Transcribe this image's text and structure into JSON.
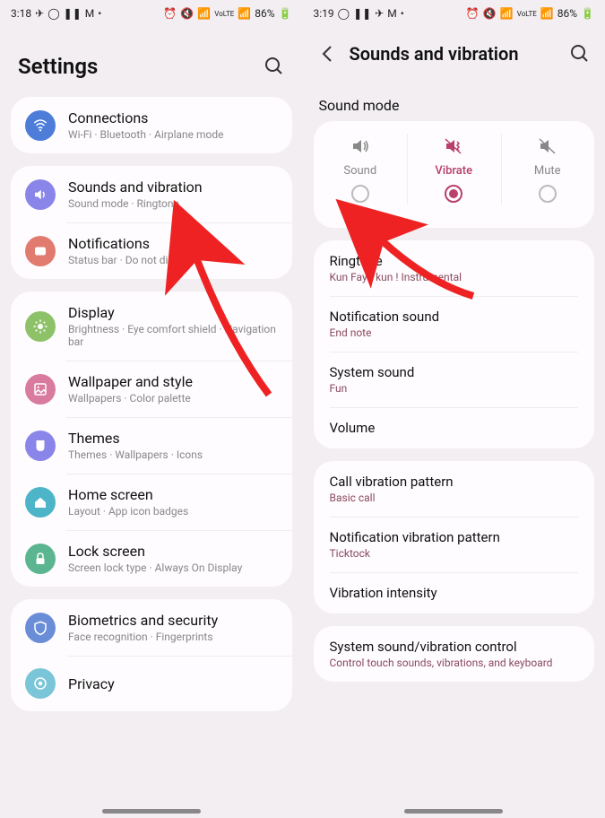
{
  "left": {
    "statusbar": {
      "time": "3:18",
      "battery": "86%"
    },
    "header": {
      "title": "Settings"
    },
    "groups": [
      {
        "items": [
          {
            "title": "Connections",
            "sub": "Wi-Fi · Bluetooth · Airplane mode",
            "color": "#4d7dd8",
            "icon": "wifi"
          }
        ]
      },
      {
        "items": [
          {
            "title": "Sounds and vibration",
            "sub": "Sound mode · Ringtone",
            "color": "#8a85e8",
            "icon": "sound"
          },
          {
            "title": "Notifications",
            "sub": "Status bar · Do not disturb",
            "color": "#e27b6f",
            "icon": "notif"
          }
        ]
      },
      {
        "items": [
          {
            "title": "Display",
            "sub": "Brightness · Eye comfort shield · Navigation bar",
            "color": "#8ec268",
            "icon": "brightness"
          },
          {
            "title": "Wallpaper and style",
            "sub": "Wallpapers · Color palette",
            "color": "#d97b9e",
            "icon": "wallpaper"
          },
          {
            "title": "Themes",
            "sub": "Themes · Wallpapers · Icons",
            "color": "#8a85e8",
            "icon": "themes"
          },
          {
            "title": "Home screen",
            "sub": "Layout · App icon badges",
            "color": "#4db5c7",
            "icon": "home"
          },
          {
            "title": "Lock screen",
            "sub": "Screen lock type · Always On Display",
            "color": "#5bb590",
            "icon": "lock"
          }
        ]
      },
      {
        "items": [
          {
            "title": "Biometrics and security",
            "sub": "Face recognition · Fingerprints",
            "color": "#6a8dd8",
            "icon": "shield"
          },
          {
            "title": "Privacy",
            "sub": "",
            "color": "#7bc5d8",
            "icon": "privacy"
          }
        ]
      }
    ]
  },
  "right": {
    "statusbar": {
      "time": "3:19",
      "battery": "86%"
    },
    "header": {
      "title": "Sounds and vibration"
    },
    "sound_mode": {
      "label": "Sound mode",
      "options": [
        {
          "label": "Sound",
          "icon": "sound"
        },
        {
          "label": "Vibrate",
          "icon": "vibrate",
          "active": true
        },
        {
          "label": "Mute",
          "icon": "mute"
        }
      ]
    },
    "groups": [
      [
        {
          "title": "Ringtone",
          "sub": "Kun Faya kun ! Instrumental"
        },
        {
          "title": "Notification sound",
          "sub": "End note"
        },
        {
          "title": "System sound",
          "sub": "Fun"
        },
        {
          "title": "Volume"
        }
      ],
      [
        {
          "title": "Call vibration pattern",
          "sub": "Basic call"
        },
        {
          "title": "Notification vibration pattern",
          "sub": "Ticktock"
        },
        {
          "title": "Vibration intensity"
        }
      ],
      [
        {
          "title": "System sound/vibration control",
          "sub": "Control touch sounds, vibrations, and keyboard"
        }
      ]
    ]
  }
}
